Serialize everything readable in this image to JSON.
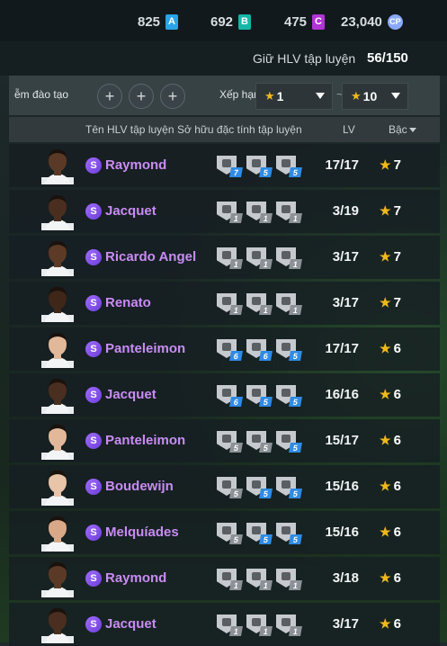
{
  "currency": {
    "a": {
      "value": "825",
      "letter": "A",
      "color": "#2aa4e8"
    },
    "b": {
      "value": "692",
      "letter": "B",
      "color": "#16b7a8"
    },
    "c": {
      "value": "475",
      "letter": "C",
      "color": "#b233d6"
    },
    "cp": {
      "value": "23,040",
      "letter": "CP"
    }
  },
  "slots": {
    "label": "Giữ HLV tập luyện",
    "value": "56/150"
  },
  "filters": {
    "tray_label": "ễm đào tạo",
    "plus_symbol": "+",
    "rank_label": "Xếp hạn",
    "min_value": "1",
    "max_value": "10",
    "star": "★",
    "tilde": "~"
  },
  "columns": {
    "name": "Tên HLV tập luyện",
    "traits": "Sở hữu đặc tính tập luyện",
    "lv": "LV",
    "grade": "Bậc"
  },
  "rows": [
    {
      "name": "Raymond",
      "lv": "17/17",
      "grade": "7",
      "skin": "#5a3a26",
      "traits": [
        {
          "icon": "trait-icon-1",
          "level": "7",
          "color": "#2e8be6"
        },
        {
          "icon": "trait-icon-2",
          "level": "5",
          "color": "#2e8be6"
        },
        {
          "icon": "trait-icon-3",
          "level": "5",
          "color": "#2e8be6"
        }
      ]
    },
    {
      "name": "Jacquet",
      "lv": "3/19",
      "grade": "7",
      "skin": "#4a2e1f",
      "traits": [
        {
          "icon": "trait-icon-4",
          "level": "1",
          "color": "#8b9196"
        },
        {
          "icon": "trait-icon-5",
          "level": "1",
          "color": "#8b9196"
        },
        {
          "icon": "trait-icon-6",
          "level": "1",
          "color": "#8b9196"
        }
      ]
    },
    {
      "name": "Ricardo Angel",
      "lv": "3/17",
      "grade": "7",
      "skin": "#5c3a26",
      "traits": [
        {
          "icon": "trait-icon-1",
          "level": "1",
          "color": "#8b9196"
        },
        {
          "icon": "trait-icon-7",
          "level": "1",
          "color": "#8b9196"
        },
        {
          "icon": "trait-icon-3",
          "level": "1",
          "color": "#8b9196"
        }
      ]
    },
    {
      "name": "Renato",
      "lv": "3/17",
      "grade": "7",
      "skin": "#3e2618",
      "traits": [
        {
          "icon": "trait-icon-5",
          "level": "1",
          "color": "#8b9196"
        },
        {
          "icon": "trait-icon-8",
          "level": "1",
          "color": "#8b9196"
        },
        {
          "icon": "trait-icon-9",
          "level": "1",
          "color": "#8b9196"
        }
      ]
    },
    {
      "name": "Panteleimon",
      "lv": "17/17",
      "grade": "6",
      "skin": "#e2b89a",
      "traits": [
        {
          "icon": "trait-icon-4",
          "level": "6",
          "color": "#2e8be6"
        },
        {
          "icon": "trait-icon-1",
          "level": "6",
          "color": "#2e8be6"
        },
        {
          "icon": "trait-icon-10",
          "level": "5",
          "color": "#2e8be6"
        }
      ]
    },
    {
      "name": "Jacquet",
      "lv": "16/16",
      "grade": "6",
      "skin": "#4a2e1f",
      "traits": [
        {
          "icon": "trait-icon-1",
          "level": "6",
          "color": "#2e8be6"
        },
        {
          "icon": "trait-icon-3",
          "level": "5",
          "color": "#2e8be6"
        },
        {
          "icon": "trait-icon-6",
          "level": "5",
          "color": "#2e8be6"
        }
      ]
    },
    {
      "name": "Panteleimon",
      "lv": "15/17",
      "grade": "6",
      "skin": "#e2b89a",
      "traits": [
        {
          "icon": "trait-icon-11",
          "level": "5",
          "color": "#8b9196"
        },
        {
          "icon": "trait-icon-5",
          "level": "5",
          "color": "#8b9196"
        },
        {
          "icon": "trait-icon-3",
          "level": "5",
          "color": "#2e8be6"
        }
      ]
    },
    {
      "name": "Boudewijn",
      "lv": "15/16",
      "grade": "6",
      "skin": "#e8c4a8",
      "traits": [
        {
          "icon": "trait-icon-1",
          "level": "5",
          "color": "#8b9196"
        },
        {
          "icon": "trait-icon-12",
          "level": "5",
          "color": "#2e8be6"
        },
        {
          "icon": "trait-icon-13",
          "level": "5",
          "color": "#2e8be6"
        }
      ]
    },
    {
      "name": "Melquíades",
      "lv": "15/16",
      "grade": "6",
      "skin": "#d8a888",
      "traits": [
        {
          "icon": "trait-icon-1",
          "level": "5",
          "color": "#8b9196"
        },
        {
          "icon": "trait-icon-3",
          "level": "5",
          "color": "#2e8be6"
        },
        {
          "icon": "trait-icon-10",
          "level": "5",
          "color": "#2e8be6"
        }
      ]
    },
    {
      "name": "Raymond",
      "lv": "3/18",
      "grade": "6",
      "skin": "#5a3a26",
      "traits": [
        {
          "icon": "trait-icon-12",
          "level": "1",
          "color": "#8b9196"
        },
        {
          "icon": "trait-icon-4",
          "level": "1",
          "color": "#8b9196"
        },
        {
          "icon": "trait-icon-9",
          "level": "1",
          "color": "#8b9196"
        }
      ]
    },
    {
      "name": "Jacquet",
      "lv": "3/17",
      "grade": "6",
      "skin": "#4a2e1f",
      "traits": [
        {
          "icon": "trait-icon-8",
          "level": "1",
          "color": "#8b9196"
        },
        {
          "icon": "trait-icon-5",
          "level": "1",
          "color": "#8b9196"
        },
        {
          "icon": "trait-icon-9",
          "level": "1",
          "color": "#8b9196"
        }
      ]
    }
  ]
}
